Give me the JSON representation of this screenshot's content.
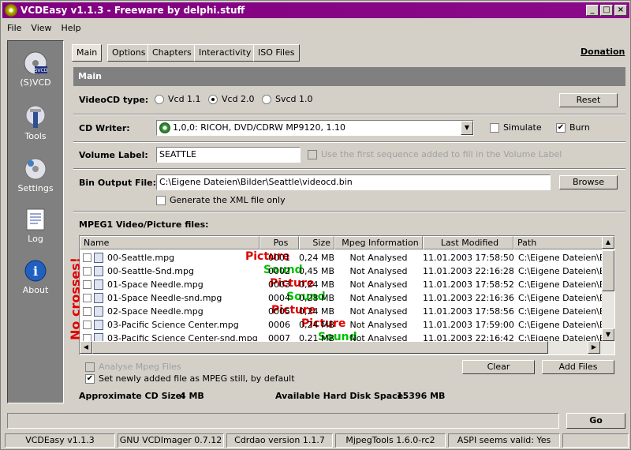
{
  "title": "VCDEasy v1.1.3 - Freeware by delphi.stuff",
  "window_buttons": {
    "minimize": "_",
    "maximize": "□",
    "close": "×"
  },
  "menu": [
    "File",
    "View",
    "Help"
  ],
  "sidebar": [
    {
      "label": "(S)VCD",
      "icon": "cd-icon"
    },
    {
      "label": "Tools",
      "icon": "tools-icon"
    },
    {
      "label": "Settings",
      "icon": "settings-icon"
    },
    {
      "label": "Log",
      "icon": "log-icon"
    },
    {
      "label": "About",
      "icon": "info-icon"
    }
  ],
  "tabs": [
    "Main",
    "Options",
    "Chapters",
    "Interactivity",
    "ISO Files"
  ],
  "donation": "Donation",
  "section_title": "Main",
  "videocd": {
    "label": "VideoCD type:",
    "options": [
      "Vcd 1.1",
      "Vcd 2.0",
      "Svcd 1.0"
    ],
    "selected": 1,
    "reset": "Reset"
  },
  "writer": {
    "label": "CD Writer:",
    "value": "1,0,0: RICOH, DVD/CDRW MP9120, 1.10",
    "simulate": "Simulate",
    "burn": "Burn",
    "burn_checked": true,
    "simulate_checked": false
  },
  "volume": {
    "label": "Volume Label:",
    "value": "SEATTLE",
    "option": "Use the first sequence added to fill in the Volume Label"
  },
  "bin": {
    "label": "Bin Output File:",
    "value": "C:\\Eigene Dateien\\Bilder\\Seattle\\videocd.bin",
    "browse": "Browse",
    "xml": "Generate the XML file only"
  },
  "files": {
    "label": "MPEG1 Video/Picture files:",
    "columns": [
      "Name",
      "Pos",
      "Size",
      "Mpeg Information",
      "Last Modified",
      "Path"
    ],
    "rows": [
      {
        "name": "00-Seattle.mpg",
        "tag": "Picture",
        "pos": "0001",
        "size": "0,24 MB",
        "info": "Not Analysed",
        "modified": "11.01.2003 17:58:50",
        "path": "C:\\Eigene Dateien\\Bild"
      },
      {
        "name": "00-Seattle-Snd.mpg",
        "tag": "Sound",
        "pos": "0002",
        "size": "0,45 MB",
        "info": "Not Analysed",
        "modified": "11.01.2003 22:16:28",
        "path": "C:\\Eigene Dateien\\Bild"
      },
      {
        "name": "01-Space Needle.mpg",
        "tag": "Picture",
        "pos": "0003",
        "size": "0,24 MB",
        "info": "Not Analysed",
        "modified": "11.01.2003 17:58:52",
        "path": "C:\\Eigene Dateien\\Bild"
      },
      {
        "name": "01-Space Needle-snd.mpg",
        "tag": "Sound",
        "pos": "0004",
        "size": "0,28 MB",
        "info": "Not Analysed",
        "modified": "11.01.2003 22:16:36",
        "path": "C:\\Eigene Dateien\\Bild"
      },
      {
        "name": "02-Space Needle.mpg",
        "tag": "Picture",
        "pos": "0005",
        "size": "0,24 MB",
        "info": "Not Analysed",
        "modified": "11.01.2003 17:58:56",
        "path": "C:\\Eigene Dateien\\Bild"
      },
      {
        "name": "03-Pacific Science Center.mpg",
        "tag": "Picture",
        "pos": "0006",
        "size": "0,24 MB",
        "info": "Not Analysed",
        "modified": "11.01.2003 17:59:00",
        "path": "C:\\Eigene Dateien\\Bild"
      },
      {
        "name": "03-Pacific Science Center-snd.mpg",
        "tag": "Sound",
        "pos": "0007",
        "size": "0,21 MB",
        "info": "Not Analysed",
        "modified": "11.01.2003 22:16:42",
        "path": "C:\\Eigene Dateien\\Bild"
      }
    ],
    "annotation": "No crosses!"
  },
  "analyse": "Analyse Mpeg Files",
  "still": "Set newly added file as MPEG still, by default",
  "clear": "Clear",
  "add": "Add Files",
  "cd_size_label": "Approximate CD Size:",
  "cd_size": "4 MB",
  "disk_label": "Available Hard Disk Space:",
  "disk": "15396 MB",
  "go": "Go",
  "status": [
    "VCDEasy v1.1.3",
    "GNU VCDImager 0.7.12",
    "Cdrdao version 1.1.7",
    "MjpegTools 1.6.0-rc2",
    "ASPI seems valid: Yes"
  ],
  "colors": {
    "titlebar": "#800080",
    "picture": "#e00000",
    "sound": "#00c000"
  }
}
